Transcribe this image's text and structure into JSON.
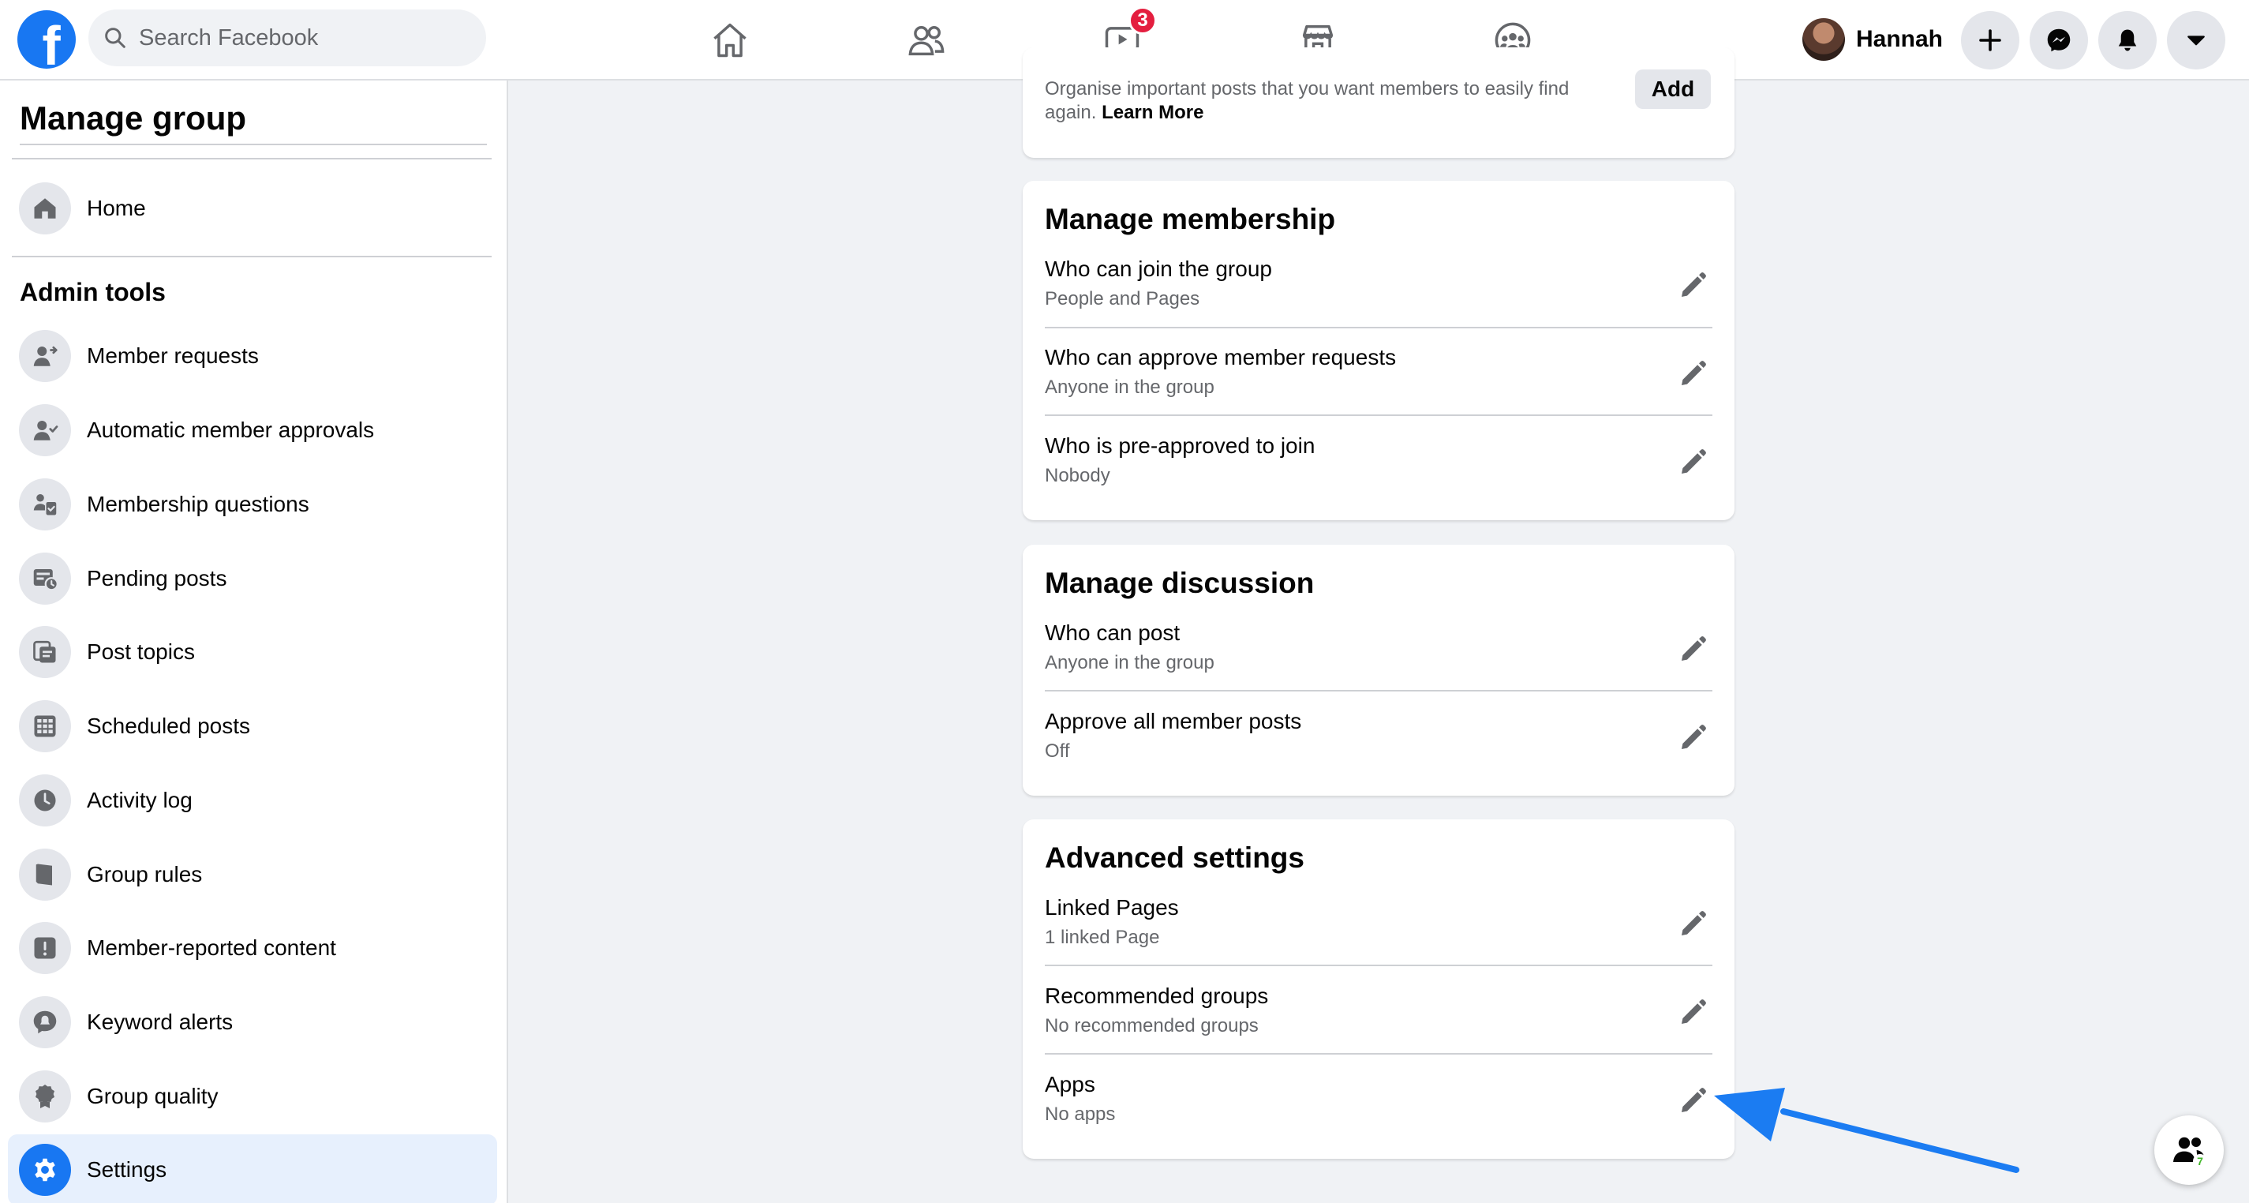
{
  "topbar": {
    "logo_letter": "f",
    "search_placeholder": "Search Facebook",
    "watch_badge": "3",
    "profile_name": "Hannah"
  },
  "sidebar": {
    "title": "Manage group",
    "home_label": "Home",
    "admin_tools_title": "Admin tools",
    "items": [
      {
        "label": "Member requests",
        "icon": "member-requests-icon"
      },
      {
        "label": "Automatic member approvals",
        "icon": "auto-approvals-icon"
      },
      {
        "label": "Membership questions",
        "icon": "membership-questions-icon"
      },
      {
        "label": "Pending posts",
        "icon": "pending-posts-icon"
      },
      {
        "label": "Post topics",
        "icon": "post-topics-icon"
      },
      {
        "label": "Scheduled posts",
        "icon": "scheduled-posts-icon"
      },
      {
        "label": "Activity log",
        "icon": "clock-icon"
      },
      {
        "label": "Group rules",
        "icon": "book-icon"
      },
      {
        "label": "Member-reported content",
        "icon": "alert-icon"
      },
      {
        "label": "Keyword alerts",
        "icon": "keyword-alert-icon"
      },
      {
        "label": "Group quality",
        "icon": "badge-icon"
      },
      {
        "label": "Settings",
        "icon": "gear-icon",
        "active": true
      }
    ]
  },
  "main": {
    "top_card": {
      "text": "Organise important posts that you want members to easily find again.",
      "learn_more": "Learn More",
      "add_label": "Add"
    },
    "membership": {
      "title": "Manage membership",
      "rows": [
        {
          "title": "Who can join the group",
          "value": "People and Pages"
        },
        {
          "title": "Who can approve member requests",
          "value": "Anyone in the group"
        },
        {
          "title": "Who is pre-approved to join",
          "value": "Nobody"
        }
      ]
    },
    "discussion": {
      "title": "Manage discussion",
      "rows": [
        {
          "title": "Who can post",
          "value": "Anyone in the group"
        },
        {
          "title": "Approve all member posts",
          "value": "Off"
        }
      ]
    },
    "advanced": {
      "title": "Advanced settings",
      "rows": [
        {
          "title": "Linked Pages",
          "value": "1 linked Page"
        },
        {
          "title": "Recommended groups",
          "value": "No recommended groups"
        },
        {
          "title": "Apps",
          "value": "No apps"
        }
      ]
    }
  },
  "floating": {
    "count": "7"
  },
  "colors": {
    "brand": "#1877f2",
    "badge": "#e41e3f",
    "arrow": "#1b7cf2"
  }
}
